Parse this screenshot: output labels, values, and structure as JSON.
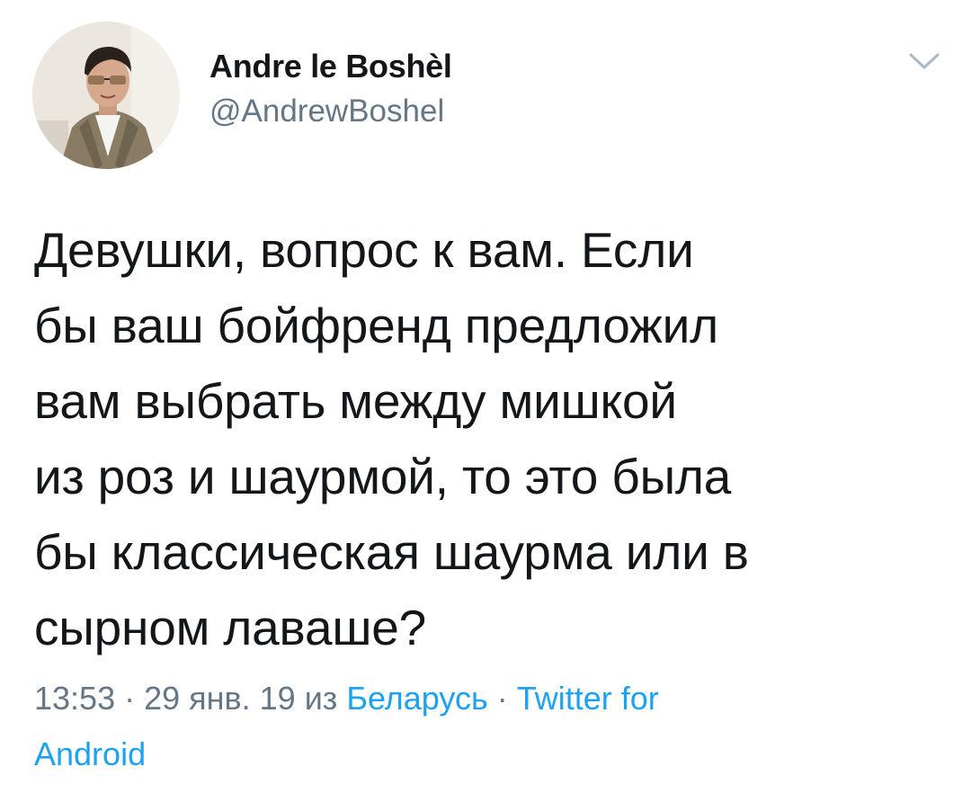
{
  "author": {
    "display_name": "Andre le Boshèl",
    "handle": "@AndrewBoshel"
  },
  "tweet": {
    "text_lines": [
      "Девушки, вопрос к вам. Если",
      "бы ваш бойфренд предложил",
      "вам выбрать между мишкой",
      "из роз и шаурмой, то это была",
      "бы классическая шаурма или в",
      "сырном лаваше?"
    ]
  },
  "meta": {
    "time": "13:53",
    "separator": " · ",
    "date": "29 янв. 19",
    "from_word": " из ",
    "location": "Беларусь",
    "separator2": " · ",
    "source_line1": "Twitter for",
    "source_line2": "Android"
  },
  "colors": {
    "text": "#14171a",
    "secondary": "#657786",
    "link": "#1da1f2",
    "caret": "#aab8c2"
  },
  "icons": {
    "menu": "chevron-down-icon"
  }
}
